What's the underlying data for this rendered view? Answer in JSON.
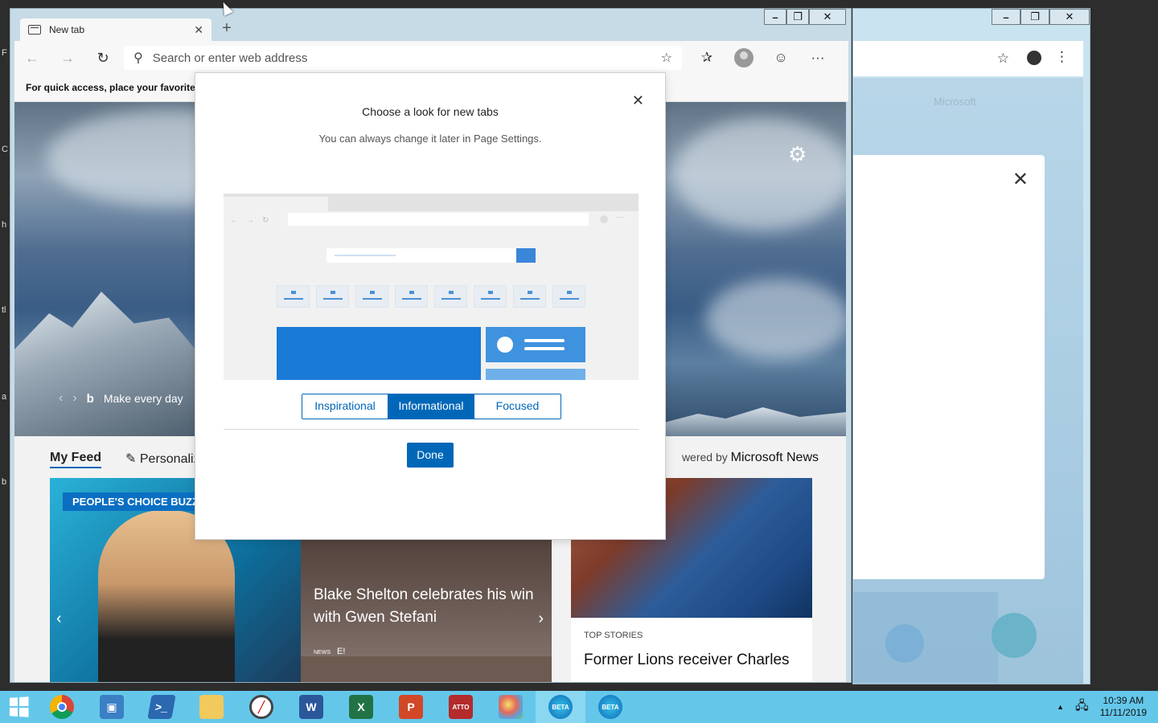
{
  "background_window": {
    "controls": [
      "–",
      "❐",
      "✕"
    ],
    "faded_text": "Microsoft"
  },
  "main_window": {
    "controls": [
      "–",
      "❐",
      "✕"
    ],
    "tab": {
      "title": "New tab",
      "close": "✕"
    },
    "new_tab": "+",
    "nav": {
      "back": "←",
      "forward": "→",
      "refresh": "↻",
      "address_placeholder": "Search or enter web address"
    },
    "favorites_bar_text": "For quick access, place your favorites h",
    "hero": {
      "caption": "Make every day"
    },
    "feed": {
      "tab_my_feed": "My Feed",
      "tab_personalize": "Personaliz",
      "powered_prefix": "wered by",
      "powered_brand": "Microsoft News",
      "card1_badge": "PEOPLE'S CHOICE BUZZ",
      "card2_title": "Blake Shelton celebrates his win with Gwen Stefani",
      "card2_source": "E!",
      "card3_category": "TOP STORIES",
      "card3_title": "Former Lions receiver Charles"
    }
  },
  "modal": {
    "title": "Choose a look for new tabs",
    "subtitle": "You can always change it later in Page Settings.",
    "options": [
      "Inspirational",
      "Informational",
      "Focused"
    ],
    "selected": "Informational",
    "done_label": "Done"
  },
  "taskbar": {
    "apps": [
      "Chrome",
      "Remote Desktop",
      "PowerShell",
      "File Explorer",
      "Clock",
      "Word",
      "Excel",
      "PowerPoint",
      "ATTO",
      "Paint",
      "Edge Beta",
      "Edge Beta"
    ],
    "tray_arrow": "▲",
    "time": "10:39 AM",
    "date": "11/11/2019"
  },
  "colors": {
    "accent": "#0067b8",
    "taskbar": "#64c7ea"
  }
}
